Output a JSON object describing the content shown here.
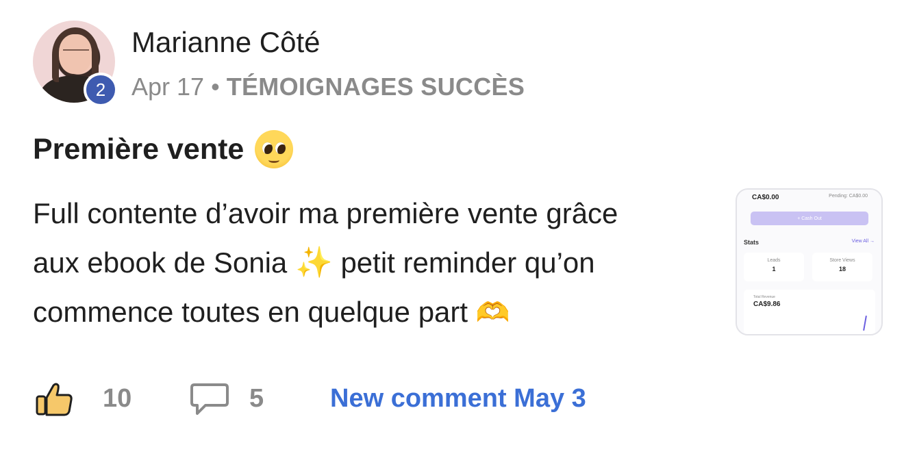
{
  "post": {
    "author": "Marianne Côté",
    "author_level": "2",
    "date": "Apr 17",
    "separator": "•",
    "category": "TÉMOIGNAGES SUCCÈS",
    "title": "Première vente",
    "body_line1": "Full contente d’avoir ma première vente grâce",
    "body_line2a": "aux ebook de Sonia",
    "body_line2b": "petit reminder qu’on",
    "body_line3": "commence toutes en quelque part",
    "emoji_title": "pleading-face-emoji",
    "emoji_sparkles": "✨",
    "emoji_heart_hands": "🫶"
  },
  "attachment": {
    "balance": "CA$0.00",
    "pending": "Pending: CA$0.00",
    "cash_out": "+ Cash Out",
    "stats_label": "Stats",
    "view_all": "View All →",
    "leads_label": "Leads",
    "leads_value": "1",
    "store_views_label": "Store Views",
    "store_views_value": "18",
    "revenue_label": "Total Revenue",
    "revenue_value": "CA$9.86"
  },
  "actions": {
    "likes": "10",
    "comments": "5",
    "new_comment": "New comment May 3"
  },
  "colors": {
    "level_badge": "#3e5bb0",
    "link_blue": "#3b6fd6",
    "meta_gray": "#8a8a8a",
    "thumb_yellow": "#f6c86a"
  }
}
